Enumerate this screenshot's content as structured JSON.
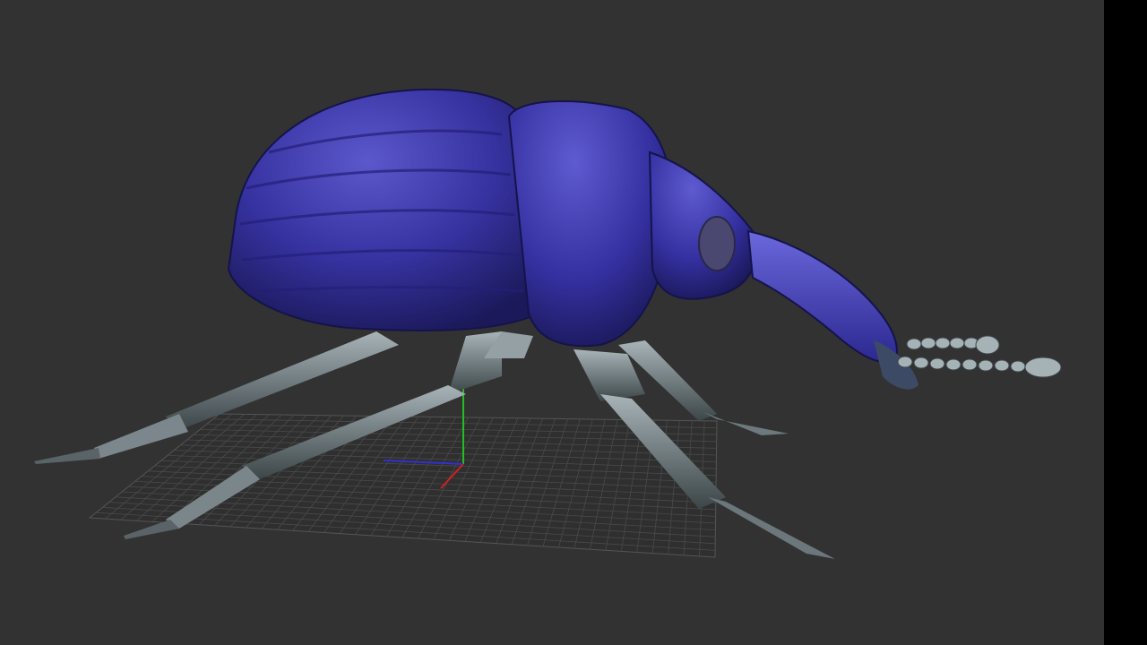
{
  "viewport": {
    "background": "#323232",
    "grid_color": "#4a4a4a",
    "axis_colors": {
      "x": "#d02020",
      "y": "#20c020",
      "z": "#3030d0"
    }
  },
  "model": {
    "subject": "weevil-beetle",
    "shell_color": "#3a35a8",
    "shell_shadow": "#1c1a60",
    "shell_highlight": "#6a68d8",
    "leg_color": "#8c9aa0",
    "leg_shadow": "#3a4448"
  },
  "right_panel": {
    "color": "#000000"
  }
}
